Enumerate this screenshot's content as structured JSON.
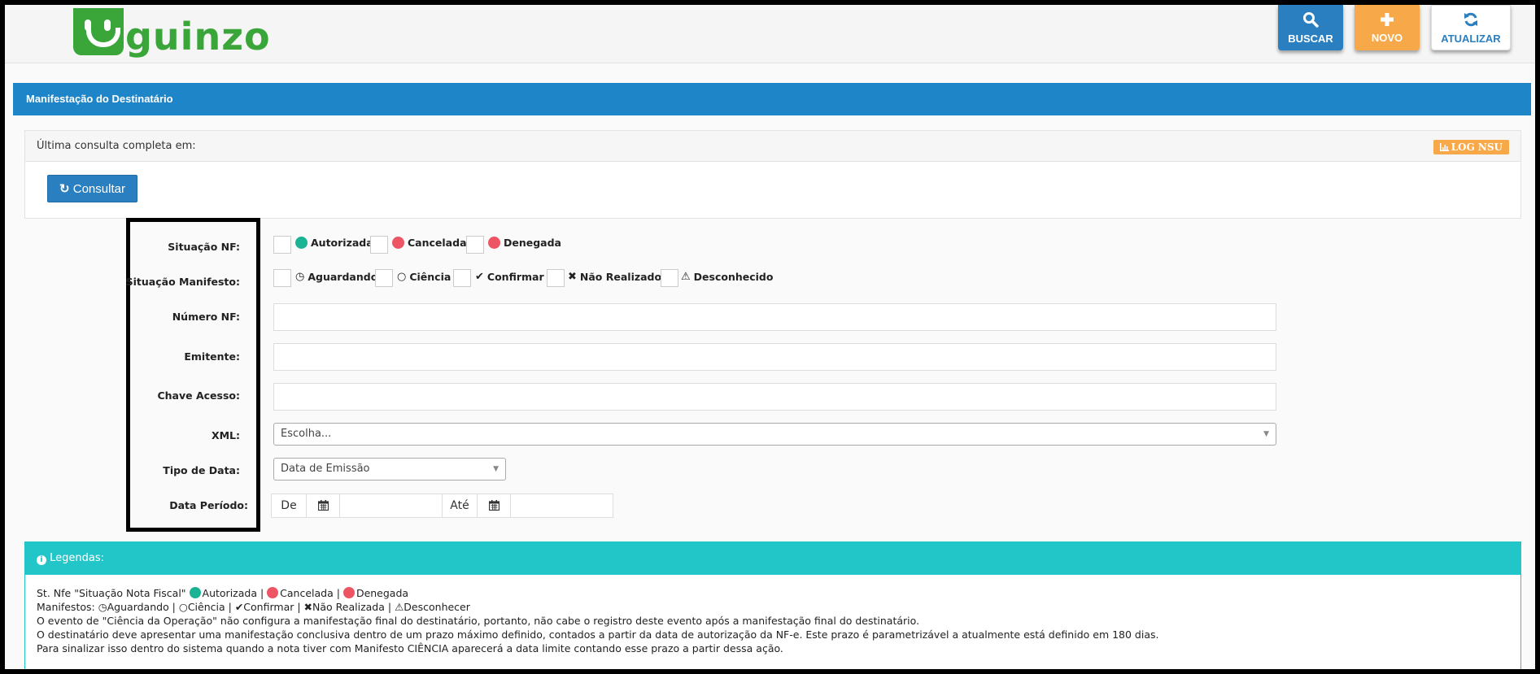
{
  "header": {
    "logo_text": "guinzo",
    "buttons": {
      "buscar": {
        "label": "BUSCAR",
        "icon": "search-icon"
      },
      "novo": {
        "label": "NOVO",
        "icon": "plus-icon"
      },
      "atualizar": {
        "label": "ATUALIZAR",
        "icon": "refresh-icon"
      }
    }
  },
  "title": "Manifestação do Destinatário",
  "consult_panel": {
    "last_query_label": "Última consulta completa em:",
    "log_nsu_label": "LOG NSU",
    "consultar_label": "Consultar"
  },
  "form": {
    "situacao_nf": {
      "label": "Situação NF:",
      "options": [
        "Autorizada",
        "Cancelada",
        "Denegada"
      ]
    },
    "situacao_manifesto": {
      "label": "Situação Manifesto:",
      "options": [
        "Aguardando",
        "Ciência",
        "Confirmar",
        "Não Realizado",
        "Desconhecido"
      ]
    },
    "numero_nf": {
      "label": "Número NF:",
      "value": ""
    },
    "emitente": {
      "label": "Emitente:",
      "value": ""
    },
    "chave_acesso": {
      "label": "Chave Acesso:",
      "value": ""
    },
    "xml": {
      "label": "XML:",
      "selected": "Escolha..."
    },
    "tipo_data": {
      "label": "Tipo de Data:",
      "selected": "Data de Emissão"
    },
    "data_periodo": {
      "label": "Data Período:",
      "de": "De",
      "ate": "Até",
      "from_value": "",
      "to_value": ""
    }
  },
  "legend": {
    "title": "Legendas:",
    "st_nfe_prefix": "St. Nfe \"Situação Nota Fiscal\"",
    "st_autorizada": "Autorizada |",
    "st_cancelada": "Cancelada |",
    "st_denegada": "Denegada",
    "manifestos_prefix": "Manifestos:",
    "m_aguardando": "Aguardando |",
    "m_ciencia": "Ciência |",
    "m_confirmar": "Confirmar |",
    "m_nao_realizada": "Não Realizada |",
    "m_desconhecer": "Desconhecer",
    "line3": "O evento de \"Ciência da Operação\" não configura a manifestação final do destinatário, portanto, não cabe o registro deste evento após a manifestação final do destinatário.",
    "line4": "O destinatário deve apresentar uma manifestação conclusiva dentro de um prazo máximo definido, contados a partir da data de autorização da NF-e. Este prazo é parametrizável a atualmente está definido em 180 dias.",
    "line5": "Para sinalizar isso dentro do sistema quando a nota tiver com Manifesto CIÊNCIA aparecerá a data limite contando esse prazo a partir dessa ação."
  },
  "colors": {
    "primary": "#1e85c9",
    "orange": "#f7a94a",
    "green_status": "#1ab394",
    "red_status": "#ed5565",
    "teal": "#23c6c8",
    "logo_green": "#3aa63a"
  }
}
